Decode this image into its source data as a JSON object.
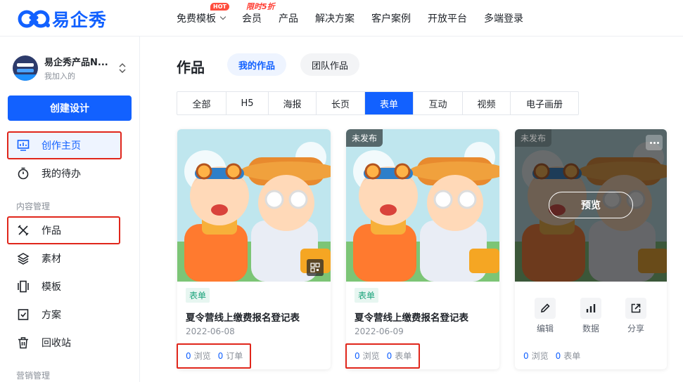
{
  "brand": {
    "name": "易企秀",
    "color": "#1261ff"
  },
  "nav": [
    {
      "label": "免费模板",
      "badge": "HOT",
      "dropdown": true
    },
    {
      "label": "会员",
      "badge": "限时5折"
    },
    {
      "label": "产品"
    },
    {
      "label": "解决方案"
    },
    {
      "label": "客户案例"
    },
    {
      "label": "开放平台"
    },
    {
      "label": "多端登录"
    }
  ],
  "sidebar": {
    "team_name": "易企秀产品N...",
    "team_role": "我加入的",
    "create_label": "创建设计",
    "items": [
      {
        "label": "创作主页",
        "icon": "monitor-icon"
      },
      {
        "label": "我的待办",
        "icon": "stopwatch-icon"
      },
      {
        "label": "作品",
        "icon": "tools-icon"
      },
      {
        "label": "素材",
        "icon": "layers-icon"
      },
      {
        "label": "模板",
        "icon": "carousel-icon"
      },
      {
        "label": "方案",
        "icon": "checklist-icon"
      },
      {
        "label": "回收站",
        "icon": "trash-icon"
      }
    ],
    "sections": [
      "内容管理",
      "营销管理"
    ]
  },
  "main": {
    "title": "作品",
    "scope_tabs": [
      "我的作品",
      "团队作品"
    ],
    "type_tabs": [
      "全部",
      "H5",
      "海报",
      "长页",
      "表单",
      "互动",
      "视频",
      "电子画册"
    ],
    "active_type": "表单",
    "cards": [
      {
        "tag": "表单",
        "title": "夏令营线上缴费报名登记表",
        "date": "2022-06-08",
        "views": "0",
        "views_label": "浏览",
        "count": "0",
        "count_label": "订单",
        "draft": ""
      },
      {
        "tag": "表单",
        "title": "夏令营线上缴费报名登记表",
        "date": "2022-06-09",
        "views": "0",
        "views_label": "浏览",
        "count": "0",
        "count_label": "表单",
        "draft": "未发布"
      },
      {
        "draft": "未发布",
        "preview_label": "预览",
        "actions": [
          "编辑",
          "数据",
          "分享"
        ],
        "views": "0",
        "views_label": "浏览",
        "count": "0",
        "count_label": "表单"
      }
    ]
  },
  "colors": {
    "accent": "#1261ff",
    "highlight_box": "#e0261b",
    "tag_bg": "#e7f6f1",
    "tag_text": "#1aa37a"
  }
}
